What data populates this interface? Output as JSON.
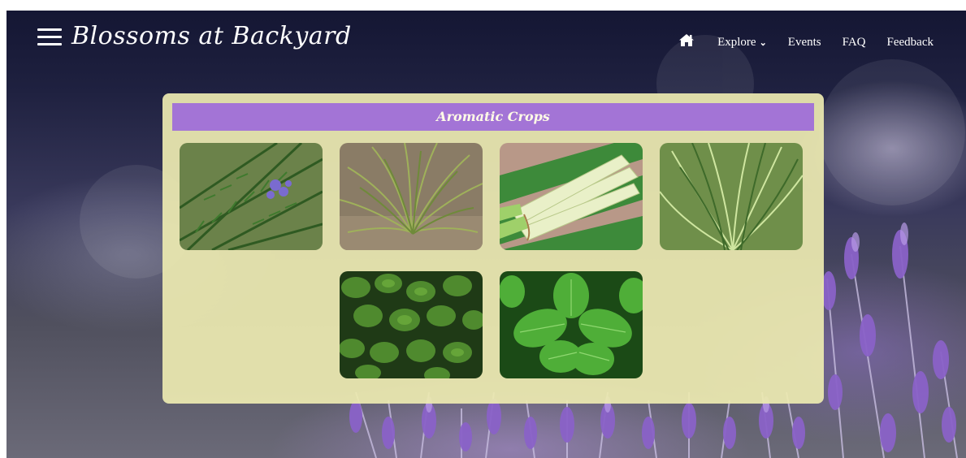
{
  "header": {
    "brand": "Blossoms at Backyard",
    "menu_icon": "hamburger-menu-icon",
    "nav": [
      {
        "label": "",
        "icon": "home-icon"
      },
      {
        "label": "Explore",
        "icon": "chevron-down-icon"
      },
      {
        "label": "Events"
      },
      {
        "label": "FAQ"
      },
      {
        "label": "Feedback"
      }
    ]
  },
  "panel": {
    "title": "Aromatic Crops",
    "title_bg": "#a374d6",
    "panel_bg": "#ece9b0"
  },
  "colors": {
    "lavender": "#8a62c8",
    "night": "#141633"
  }
}
